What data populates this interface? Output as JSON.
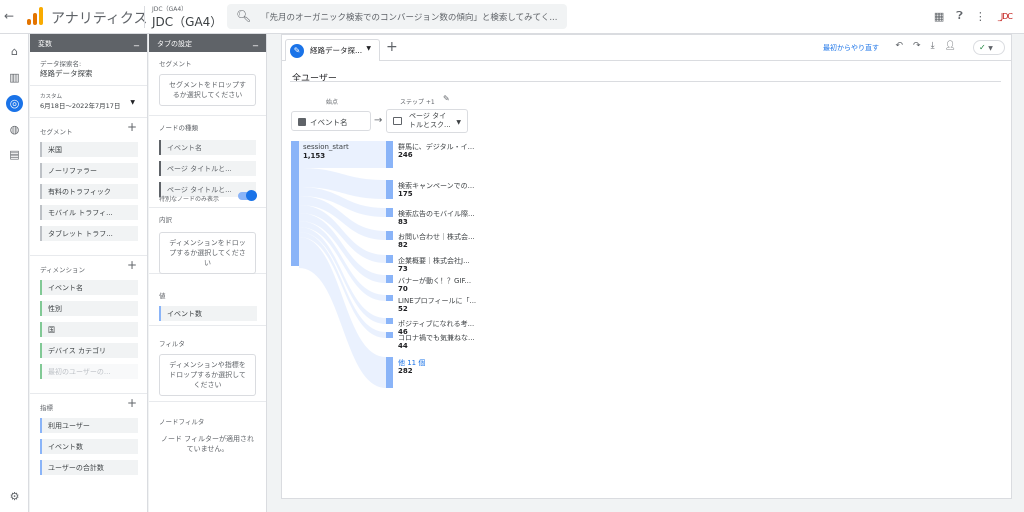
{
  "topbar": {
    "back_icon": "arrow-back-icon",
    "app_name": "アナリティクス",
    "property_account": "JDC（GA4）",
    "property_name": "JDC（GA4）",
    "search_placeholder": "「先月のオーガニック検索でのコンバージョン数の傾向」と検索してみてく...",
    "brand": "_JDC",
    "logo_colors": [
      "#f9ab00",
      "#e37400",
      "#e37400"
    ]
  },
  "variables_panel": {
    "header": "変数",
    "exploration_name_label": "データ探索名:",
    "exploration_name": "経路データ探索",
    "date_label": "カスタム",
    "date_range": "6月18日～2022年7月17日",
    "segments_label": "セグメント",
    "segments": [
      "米国",
      "ノーリファラー",
      "有料のトラフィック",
      "モバイル トラフィ...",
      "タブレット トラフ..."
    ],
    "dimensions_label": "ディメンション",
    "dimensions": [
      "イベント名",
      "性別",
      "国",
      "デバイス カテゴリ",
      "最初のユーザーの..."
    ],
    "metrics_label": "指標",
    "metrics": [
      "利用ユーザー",
      "イベント数",
      "ユーザーの合計数"
    ]
  },
  "settings_panel": {
    "header": "タブの設定",
    "segment_label": "セグメント",
    "segment_drop": "セグメントをドロップするか選択してください",
    "node_type_label": "ノードの種類",
    "node_types": [
      "イベント名",
      "ページ タイトルと...",
      "ページ タイトルと..."
    ],
    "unique_nodes_label": "特別なノードのみ表示",
    "unique_nodes_on": true,
    "breakdown_label": "内訳",
    "breakdown_drop": "ディメンションをドロップするか選択してください",
    "values_label": "値",
    "value_chip": "イベント数",
    "filter_label": "フィルタ",
    "filter_drop": "ディメンションや指標をドロップするか選択してください",
    "node_filter_label": "ノードフィルタ",
    "node_filter_text": "ノード フィルターが適用されていません。"
  },
  "main": {
    "tab_label": "経路データ探...",
    "restart": "最初からやり直す",
    "tool_icons": [
      "undo-icon",
      "redo-icon",
      "download-icon",
      "share-icon"
    ],
    "status": "✓",
    "segment_title": "全ユーザー",
    "start_label": "始点",
    "step_label": "ステップ +1",
    "start_select": "イベント名",
    "step_select_line1": "ページ タイ",
    "step_select_line2": "トルとスク...",
    "start_node": {
      "label": "session_start",
      "value": "1,153"
    },
    "step_nodes": [
      {
        "label": "群馬に、デジタル・イ...",
        "value": "246"
      },
      {
        "label": "検索キャンペーンでの...",
        "value": "175"
      },
      {
        "label": "検索広告のモバイル際...",
        "value": "83"
      },
      {
        "label": "お問い合わせ｜株式会...",
        "value": "82"
      },
      {
        "label": "企業概要｜株式会社J...",
        "value": "73"
      },
      {
        "label": "バナーが動く！？GIF...",
        "value": "70"
      },
      {
        "label": "LINEプロフィールに「...",
        "value": "52"
      },
      {
        "label": "ポジティブになれる考...",
        "value": "46"
      },
      {
        "label": "コロナ禍でも気兼ねな...",
        "value": "44"
      },
      {
        "label": "他 11 個",
        "value": "282",
        "link": true
      }
    ],
    "node_color": "#8ab4f8",
    "link_color": "#1a73e8"
  }
}
